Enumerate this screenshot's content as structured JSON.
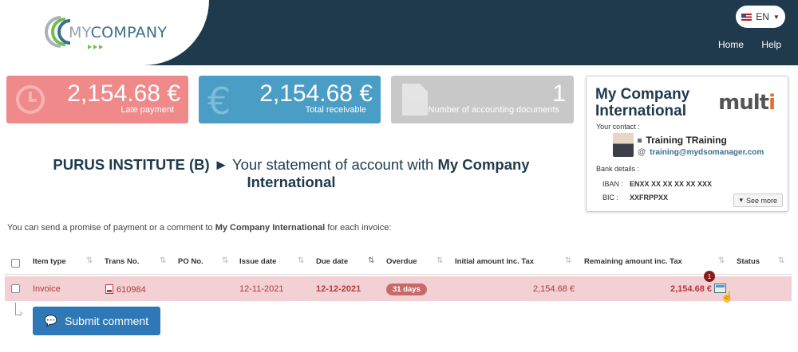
{
  "header": {
    "logo": {
      "my": "MY",
      "company": "COMPANY"
    },
    "lang": "EN",
    "nav": [
      "Home",
      "Help"
    ]
  },
  "cards": [
    {
      "value": "2,154.68 €",
      "label": "Late payment",
      "icon": "clock-icon",
      "color": "#f08a8a"
    },
    {
      "value": "2,154.68 €",
      "label": "Total receivable",
      "icon": "euro-icon",
      "color": "#4a9ec6"
    },
    {
      "value": "1",
      "label": "Number of accounting documents",
      "icon": "document-icon",
      "color": "#c8c8c8"
    }
  ],
  "company": {
    "name": "My Company International",
    "brand": "mult",
    "brand_dot": "i",
    "contact_label": "Your contact :",
    "contact_name": "Training TRaining",
    "contact_email": "training@mydsomanager.com",
    "at_sign": "@",
    "bank_label": "Bank details :",
    "iban_label": "IBAN :",
    "iban": "ENXX XX XX XX XX XXX",
    "bic_label": "BIC :",
    "bic": "XXFRPPXX",
    "see_more": "See more"
  },
  "statement": {
    "client": "PURUS INSTITUTE (B)",
    "arrow": "►",
    "text": "Your statement of account with",
    "company": "My Company International"
  },
  "instruction": {
    "before": "You can send a promise of payment or a comment to",
    "company": "My Company International",
    "after": "for each invoice:"
  },
  "table": {
    "columns": [
      "Item type",
      "Trans No.",
      "PO No.",
      "Issue date",
      "Due date",
      "Overdue",
      "Initial amount inc. Tax",
      "Remaining amount inc. Tax",
      "Status"
    ],
    "rows": [
      {
        "item_type": "Invoice",
        "trans_no": "610984",
        "po_no": "",
        "issue_date": "12-11-2021",
        "due_date": "12-12-2021",
        "overdue": "31 days",
        "initial_amount": "2,154.68 €",
        "remaining_amount": "2,154.68 €",
        "comment_count": "1",
        "status": ""
      }
    ]
  },
  "submit_label": "Submit comment"
}
